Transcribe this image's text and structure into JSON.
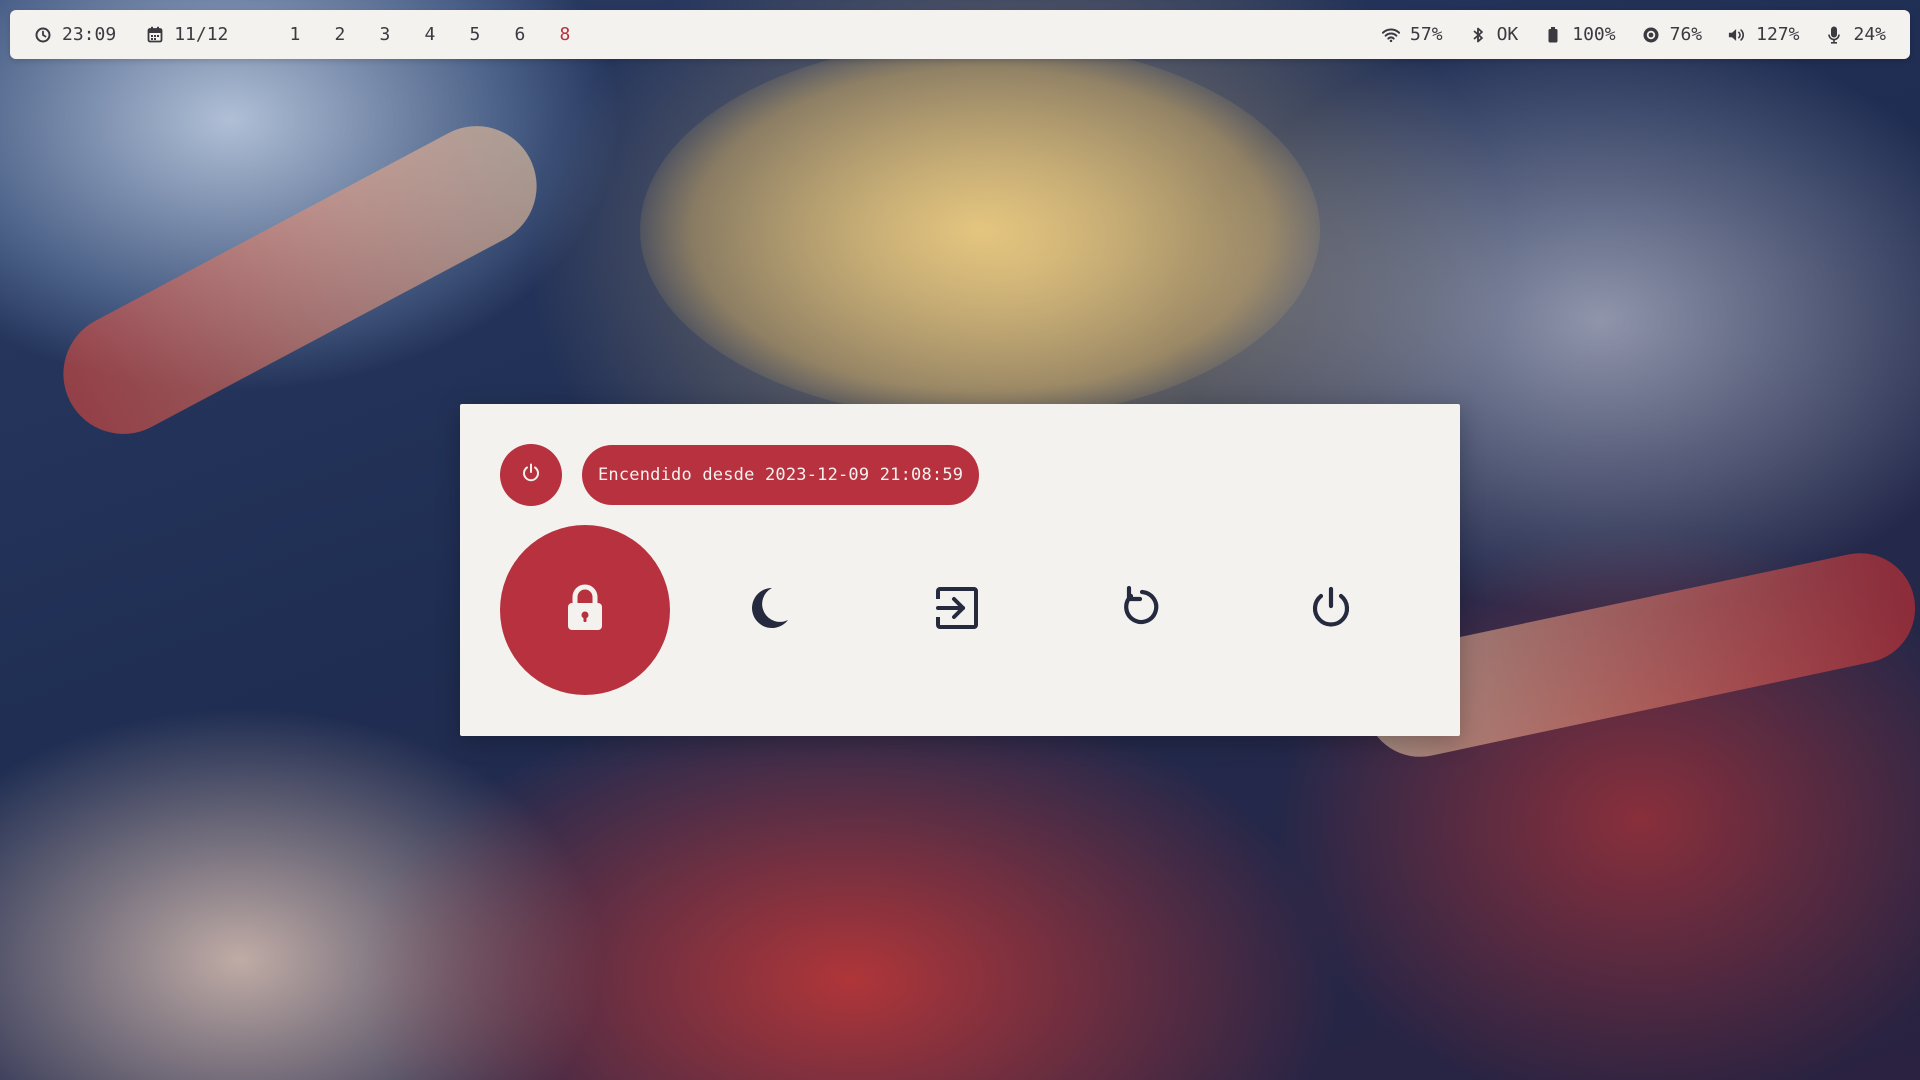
{
  "colors": {
    "accent": "#b7313f",
    "surface": "#f4f2ef",
    "text": "#3a3a40"
  },
  "topbar": {
    "clock": {
      "icon": "clock-icon",
      "time": "23:09"
    },
    "date": {
      "icon": "calendar-icon",
      "value": "11/12"
    },
    "workspaces": [
      "1",
      "2",
      "3",
      "4",
      "5",
      "6",
      "8"
    ],
    "active_workspace": "8",
    "wifi": {
      "icon": "wifi-icon",
      "value": "57%"
    },
    "bluetooth": {
      "icon": "bluetooth-icon",
      "value": "OK"
    },
    "battery": {
      "icon": "battery-icon",
      "value": "100%"
    },
    "brightness": {
      "icon": "brightness-icon",
      "value": "76%"
    },
    "volume": {
      "icon": "volume-icon",
      "value": "127%"
    },
    "microphone": {
      "icon": "microphone-icon",
      "value": "24%"
    }
  },
  "power_menu": {
    "uptime_icon": "power-icon",
    "uptime_text": "Encendido desde 2023-12-09 21:08:59",
    "actions": [
      {
        "name": "lock",
        "icon": "lock-icon",
        "selected": true
      },
      {
        "name": "sleep",
        "icon": "moon-icon",
        "selected": false
      },
      {
        "name": "logout",
        "icon": "logout-icon",
        "selected": false
      },
      {
        "name": "reboot",
        "icon": "reboot-icon",
        "selected": false
      },
      {
        "name": "shutdown",
        "icon": "power-icon",
        "selected": false
      }
    ]
  }
}
